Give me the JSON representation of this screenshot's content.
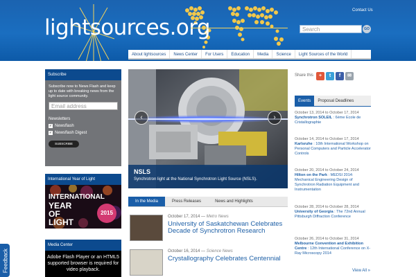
{
  "header": {
    "logo": "lightsources.org",
    "contact": "Contact Us",
    "search_placeholder": "Search",
    "search_button": "GO"
  },
  "nav": [
    "About lightsources",
    "News Center",
    "For Users",
    "Education",
    "Media",
    "Science",
    "Light Sources of the World"
  ],
  "subscribe": {
    "title": "Subscribe",
    "text": "Subscribe now to News Flash and keep up to date with breaking news from the light source community.",
    "email_placeholder": "Email address",
    "newsletters_label": "Newsletters",
    "options": [
      "Newsflash",
      "Newsflash Digest"
    ],
    "button": "SUBSCRIBE"
  },
  "iyl": {
    "title": "International Year of Light",
    "line1": "INTERNATIONAL",
    "line2": "YEAR",
    "line3": "OF",
    "line4": "LIGHT",
    "year": "2015"
  },
  "media_center": {
    "title": "Media Center",
    "text": "Adobe Flash Player or an HTML5 supported browser is required for video playback."
  },
  "feedback": "Feedback",
  "slide": {
    "title": "NSLS",
    "caption": "Synchrotron light at the National Synchrotron Light Source (NSLS)."
  },
  "center_tabs": [
    "In the Media",
    "Press Releases",
    "News and Highlights"
  ],
  "news": [
    {
      "date": "October 17, 2014",
      "source": "Metro News",
      "title": "University of Saskatchewan Celebrates Decade of Synchrotron Research"
    },
    {
      "date": "October 16, 2014",
      "source": "Science News",
      "title": "Crystallography Celebrates Centennial"
    }
  ],
  "share": {
    "label": "Share this",
    "icons": [
      "google-plus-icon",
      "twitter-icon",
      "facebook-icon",
      "email-icon"
    ]
  },
  "right_tabs": [
    "Events",
    "Proposal Deadlines"
  ],
  "events": [
    {
      "date": "October 13, 2014 to October 17, 2014",
      "name": "Synchrotron SOLEIL",
      "desc": " : 6ème Ecole de Cristallographie"
    },
    {
      "date": "October 14, 2014 to October 17, 2014",
      "name": "Karlsruhe",
      "desc": " : 10th International Workshop on Personal Computers and Particle Accelerator Controls"
    },
    {
      "date": "October 20, 2014 to October 24, 2014",
      "name": "Hilton on the Park",
      "desc": " : MEDSI 2014: Mechanical Engineering Design of Synchrotron Radiation Equipment and Instrumentation"
    },
    {
      "date": "October 28, 2014 to October 28, 2014",
      "name": "University of Georgia",
      "desc": " : The 72nd Annual Pittsburgh Diffraction Conference"
    },
    {
      "date": "October 26, 2014 to October 31, 2014",
      "name": "Melbourne Convention and Exhibition Centre",
      "desc": " : 12th International Conference on X-Ray Microscopy 2014"
    }
  ],
  "view_all": "View All »",
  "colors": {
    "brand_blue": "#1a5ea8",
    "dark_blue": "#0c4a8e",
    "link": "#1d5fa6"
  }
}
